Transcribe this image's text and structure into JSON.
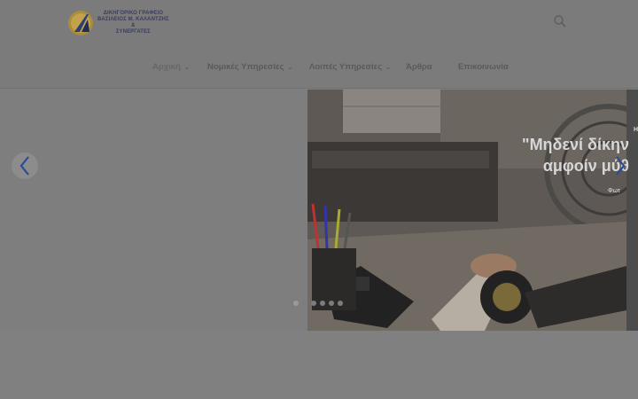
{
  "header": {
    "logo": {
      "lines": [
        "ΔΙΚΗΓΟΡΙΚΟ ΓΡΑΦΕΙΟ",
        "ΒΑΣΙΛΕΙΟΣ Μ. ΚΑΛΑΝΤΖΗΣ",
        "&",
        "ΣΥΝΕΡΓΑΤΕΣ"
      ]
    },
    "nav": [
      {
        "label": "Αρχική",
        "has_dropdown": true
      },
      {
        "label": "Νομικές Υπηρεσίες",
        "has_dropdown": true
      },
      {
        "label": "Λοιπές Υπηρεσίες",
        "has_dropdown": true
      },
      {
        "label": "Άρθρα",
        "has_dropdown": false
      },
      {
        "label": "Επικοινωνία",
        "has_dropdown": false
      }
    ],
    "search_icon": "search-icon"
  },
  "slider": {
    "quote_line1": "\"Μηδενί δίκην",
    "quote_line2": "αμφοίν μύθ",
    "caption": "Φωτ",
    "sliver_text": "Η",
    "prev_icon": "chevron-left-icon",
    "next_icon": "chevron-right-icon",
    "dots": [
      {
        "active": true
      },
      {
        "active": false
      },
      {
        "active": false
      },
      {
        "active": false
      },
      {
        "active": false
      },
      {
        "active": false
      }
    ],
    "arrow_color": "#1e3a8a"
  }
}
